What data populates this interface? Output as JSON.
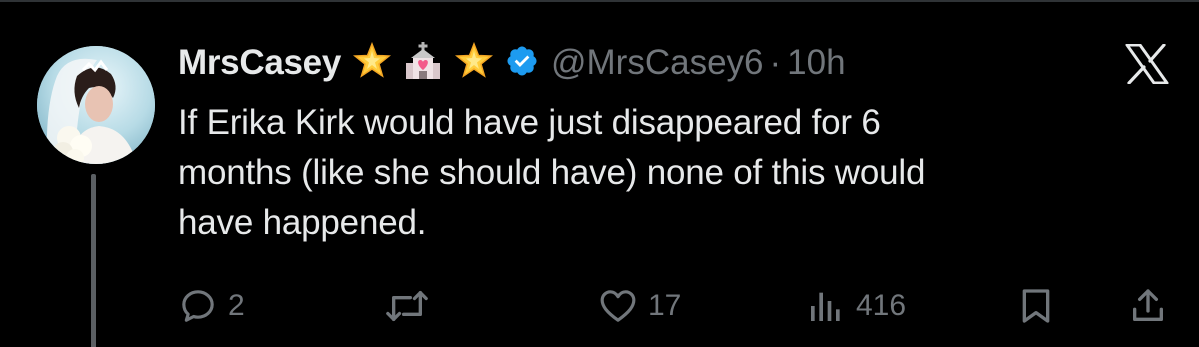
{
  "tweet": {
    "display_name": "MrsCasey",
    "badges": [
      "star-emoji",
      "wedding-chapel-emoji",
      "star-emoji"
    ],
    "verified": true,
    "handle": "@MrsCasey6",
    "separator": "·",
    "time": "10h",
    "text_lines": [
      "If Erika Kirk would have just disappeared for 6",
      "months (like she should have) none of this would",
      "have happened."
    ],
    "accent_color": "#1d9bf0"
  },
  "actions": {
    "replies": "2",
    "retweets": "",
    "likes": "17",
    "views": "416"
  }
}
